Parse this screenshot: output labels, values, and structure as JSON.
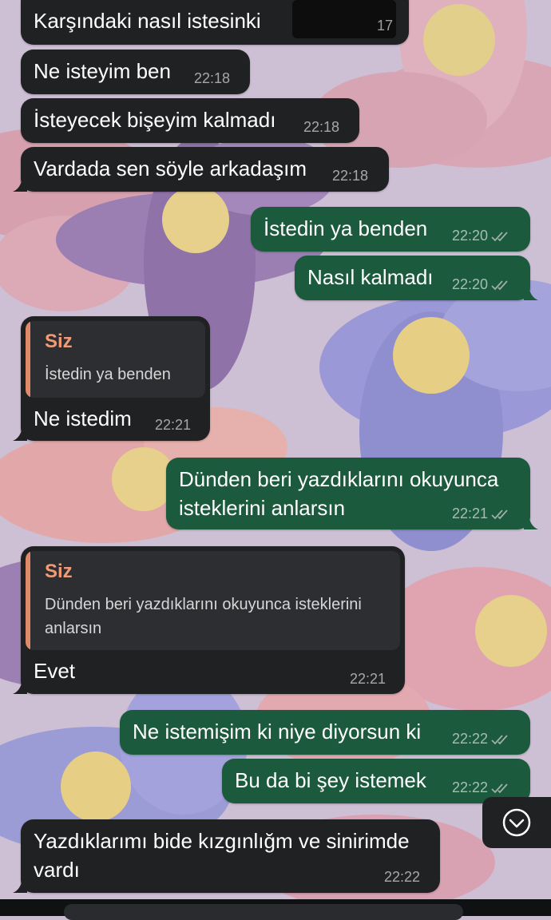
{
  "colors": {
    "incoming_bubble": "#202123",
    "outgoing_bubble": "#1b5a3c",
    "quote_accent": "#ef9b78",
    "read_ticks": "#9fb0a6"
  },
  "messages": [
    {
      "id": "m1",
      "direction": "incoming",
      "text": "Karşındaki nasıl istesinki",
      "time": "17"
    },
    {
      "id": "m2",
      "direction": "incoming",
      "text": "Ne isteyim ben",
      "time": "22:18"
    },
    {
      "id": "m3",
      "direction": "incoming",
      "text": "İsteyecek bişeyim kalmadı",
      "time": "22:18"
    },
    {
      "id": "m4",
      "direction": "incoming",
      "text": "Vardada sen söyle arkadaşım",
      "time": "22:18"
    },
    {
      "id": "m5",
      "direction": "outgoing",
      "text": "İstedin ya benden",
      "time": "22:20",
      "status": "read"
    },
    {
      "id": "m6",
      "direction": "outgoing",
      "text": "Nasıl kalmadı",
      "time": "22:20",
      "status": "read"
    },
    {
      "id": "m7",
      "direction": "incoming",
      "quote": {
        "author": "Siz",
        "text": "İstedin ya benden"
      },
      "text": "Ne istedim",
      "time": "22:21"
    },
    {
      "id": "m8",
      "direction": "outgoing",
      "text": "Dünden beri yazdıklarını okuyunca isteklerini anlarsın",
      "time": "22:21",
      "status": "read"
    },
    {
      "id": "m9",
      "direction": "incoming",
      "quote": {
        "author": "Siz",
        "text": "Dünden beri yazdıklarını okuyunca isteklerini anlarsın"
      },
      "text": "Evet",
      "time": "22:21"
    },
    {
      "id": "m10",
      "direction": "outgoing",
      "text": "Ne istemişim ki niye diyorsun ki",
      "time": "22:22",
      "status": "read"
    },
    {
      "id": "m11",
      "direction": "outgoing",
      "text": "Bu da bi şey istemek",
      "time": "22:22",
      "status": "read"
    },
    {
      "id": "m12",
      "direction": "incoming",
      "text": "Yazdıklarımı bide kızgınlığm ve sinirimde vardı",
      "time": "22:22"
    }
  ],
  "scroll_button": {
    "icon": "chevron-down-icon"
  }
}
